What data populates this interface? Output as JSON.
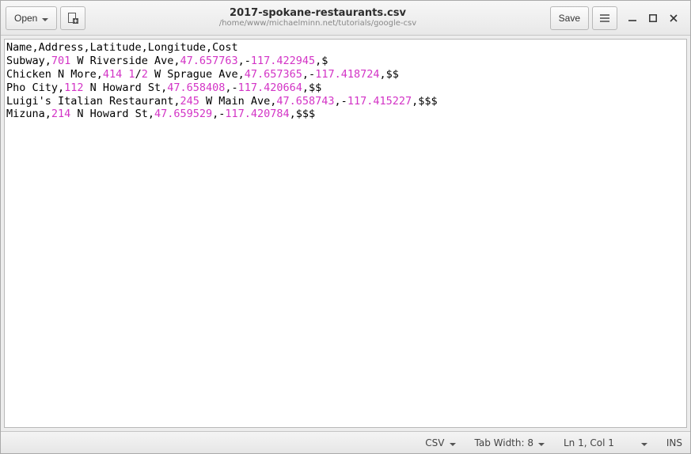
{
  "header": {
    "open_label": "Open",
    "save_label": "Save",
    "title": "2017-spokane-restaurants.csv",
    "subtitle": "/home/www/michaelminn.net/tutorials/google-csv"
  },
  "editor": {
    "lines": [
      [
        {
          "t": "Name,Address,Latitude,Longitude,Cost",
          "n": false
        }
      ],
      [
        {
          "t": "Subway,",
          "n": false
        },
        {
          "t": "701",
          "n": true
        },
        {
          "t": " W Riverside Ave,",
          "n": false
        },
        {
          "t": "47.657763",
          "n": true
        },
        {
          "t": ",-",
          "n": false
        },
        {
          "t": "117.422945",
          "n": true
        },
        {
          "t": ",$",
          "n": false
        }
      ],
      [
        {
          "t": "Chicken N More,",
          "n": false
        },
        {
          "t": "414 1",
          "n": true
        },
        {
          "t": "/",
          "n": false
        },
        {
          "t": "2",
          "n": true
        },
        {
          "t": " W Sprague Ave,",
          "n": false
        },
        {
          "t": "47.657365",
          "n": true
        },
        {
          "t": ",-",
          "n": false
        },
        {
          "t": "117.418724",
          "n": true
        },
        {
          "t": ",$$",
          "n": false
        }
      ],
      [
        {
          "t": "Pho City,",
          "n": false
        },
        {
          "t": "112",
          "n": true
        },
        {
          "t": " N Howard St,",
          "n": false
        },
        {
          "t": "47.658408",
          "n": true
        },
        {
          "t": ",-",
          "n": false
        },
        {
          "t": "117.420664",
          "n": true
        },
        {
          "t": ",$$",
          "n": false
        }
      ],
      [
        {
          "t": "Luigi's Italian Restaurant,",
          "n": false
        },
        {
          "t": "245",
          "n": true
        },
        {
          "t": " W Main Ave,",
          "n": false
        },
        {
          "t": "47.658743",
          "n": true
        },
        {
          "t": ",-",
          "n": false
        },
        {
          "t": "117.415227",
          "n": true
        },
        {
          "t": ",$$$",
          "n": false
        }
      ],
      [
        {
          "t": "Mizuna,",
          "n": false
        },
        {
          "t": "214",
          "n": true
        },
        {
          "t": " N Howard St,",
          "n": false
        },
        {
          "t": "47.659529",
          "n": true
        },
        {
          "t": ",-",
          "n": false
        },
        {
          "t": "117.420784",
          "n": true
        },
        {
          "t": ",$$$",
          "n": false
        }
      ]
    ]
  },
  "statusbar": {
    "language": "CSV",
    "tab_width": "Tab Width: 8",
    "position": "Ln 1, Col 1",
    "insert_mode": "INS"
  }
}
